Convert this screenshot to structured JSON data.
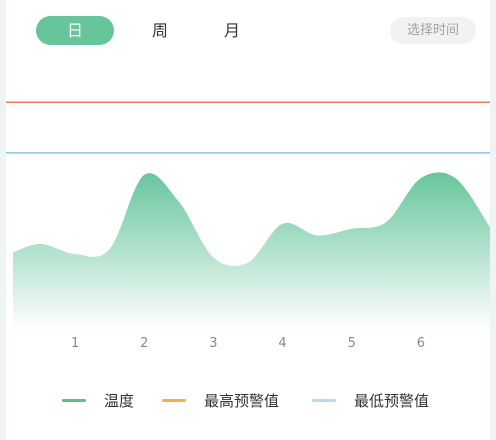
{
  "tabs": [
    {
      "label": "日",
      "selected": true
    },
    {
      "label": "周",
      "selected": false
    },
    {
      "label": "月",
      "selected": false
    }
  ],
  "select_time_label": "选择时间",
  "colors": {
    "accent": "#67c59c",
    "temperature": "#5cbf8e",
    "max_warning": "#f0b34a",
    "min_warning": "#bcd7f0",
    "max_line": "#e87d6a",
    "min_line": "#8fbde8"
  },
  "chart_data": {
    "type": "area",
    "x": [
      0.1,
      0.5,
      1.0,
      1.5,
      2.0,
      2.5,
      3.0,
      3.5,
      4.0,
      4.5,
      5.0,
      5.5,
      6.0,
      6.5,
      7.0
    ],
    "series": [
      {
        "name": "温度",
        "values": [
          4.6,
          5.1,
          4.5,
          4.8,
          9.2,
          7.6,
          4.3,
          4.0,
          6.3,
          5.6,
          6.0,
          6.4,
          9.0,
          9.0,
          6.1
        ]
      },
      {
        "name": "最高预警值",
        "values": [
          13.5,
          13.5,
          13.5,
          13.5,
          13.5,
          13.5,
          13.5,
          13.5,
          13.5,
          13.5,
          13.5,
          13.5,
          13.5,
          13.5,
          13.5
        ]
      },
      {
        "name": "最低预警值",
        "values": [
          10.5,
          10.5,
          10.5,
          10.5,
          10.5,
          10.5,
          10.5,
          10.5,
          10.5,
          10.5,
          10.5,
          10.5,
          10.5,
          10.5,
          10.5
        ]
      }
    ],
    "x_ticks": [
      "1",
      "2",
      "3",
      "4",
      "5",
      "6"
    ],
    "xlim": [
      0.0,
      7.0
    ],
    "ylim": [
      0,
      16
    ],
    "grid": false,
    "legend": "bottom"
  },
  "legend": [
    {
      "label": "温度",
      "color": "#5cbf8e"
    },
    {
      "label": "最高预警值",
      "color": "#f0b34a"
    },
    {
      "label": "最低预警值",
      "color": "#bcd7f0"
    }
  ]
}
